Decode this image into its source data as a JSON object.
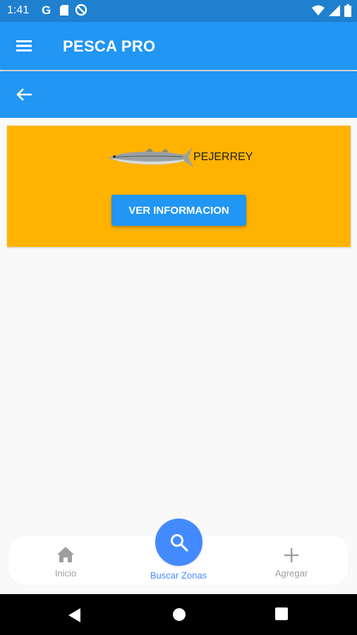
{
  "status_bar": {
    "time": "1:41",
    "left_icons": [
      "google-icon",
      "sd-card-icon",
      "do-not-disturb-icon"
    ],
    "right_icons": [
      "wifi-icon",
      "signal-icon",
      "battery-icon"
    ]
  },
  "app_bar": {
    "title": "PESCA PRO",
    "menu_icon": "menu-icon"
  },
  "sub_bar": {
    "back_icon": "arrow-back-icon"
  },
  "fish_card": {
    "name": "PEJERREY",
    "button_label": "VER INFORMACION",
    "background_color": "#ffb300"
  },
  "bottom_nav": {
    "items": [
      {
        "label": "Inicio",
        "icon": "home-icon",
        "active": false
      },
      {
        "label": "Buscar Zonas",
        "icon": "search-icon",
        "active": true
      },
      {
        "label": "Agregar",
        "icon": "plus-icon",
        "active": false
      }
    ]
  },
  "colors": {
    "primary": "#2196f3",
    "status_bar": "#1f80d0",
    "accent": "#448aff",
    "inactive": "#9e9e9e"
  },
  "system_nav": {
    "buttons": [
      "back-triangle-icon",
      "home-circle-icon",
      "recents-square-icon"
    ]
  }
}
